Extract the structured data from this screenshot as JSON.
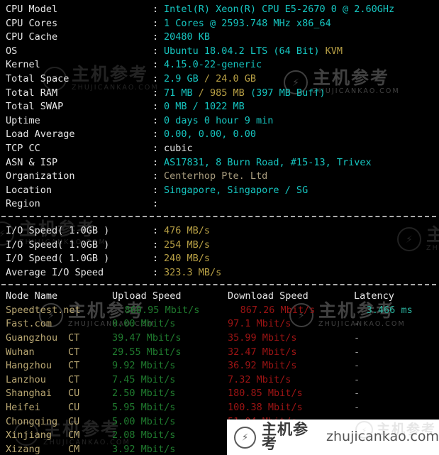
{
  "system_info": {
    "rows": [
      {
        "label": "CPU Model",
        "segments": [
          {
            "text": "Intel(R) Xeon(R) CPU E5-2670 0 @ 2.60GHz",
            "color": "cyan"
          }
        ]
      },
      {
        "label": "CPU Cores",
        "segments": [
          {
            "text": "1 Cores @ 2593.748 MHz x86_64",
            "color": "cyan"
          }
        ]
      },
      {
        "label": "CPU Cache",
        "segments": [
          {
            "text": "20480 KB",
            "color": "cyan"
          }
        ]
      },
      {
        "label": "OS",
        "segments": [
          {
            "text": "Ubuntu 18.04.2 LTS (64 Bit) ",
            "color": "cyan"
          },
          {
            "text": "KVM",
            "color": "yellow"
          }
        ]
      },
      {
        "label": "Kernel",
        "segments": [
          {
            "text": "4.15.0-22-generic",
            "color": "cyan"
          }
        ]
      },
      {
        "label": "Total Space",
        "segments": [
          {
            "text": "2.9 GB ",
            "color": "cyan"
          },
          {
            "text": "/ 24.0 GB",
            "color": "yellow"
          }
        ]
      },
      {
        "label": "Total RAM",
        "segments": [
          {
            "text": "71 MB ",
            "color": "cyan"
          },
          {
            "text": "/ 985 MB ",
            "color": "yellow"
          },
          {
            "text": "(397 MB Buff)",
            "color": "cyan"
          }
        ]
      },
      {
        "label": "Total SWAP",
        "segments": [
          {
            "text": "0 MB / 1022 MB",
            "color": "cyan"
          }
        ]
      },
      {
        "label": "Uptime",
        "segments": [
          {
            "text": "0 days 0 hour 9 min",
            "color": "cyan"
          }
        ]
      },
      {
        "label": "Load Average",
        "segments": [
          {
            "text": "0.00, 0.00, 0.00",
            "color": "cyan"
          }
        ]
      },
      {
        "label": "TCP CC",
        "segments": [
          {
            "text": "cubic",
            "color": "white"
          }
        ]
      },
      {
        "label": "ASN & ISP",
        "segments": [
          {
            "text": "AS17831, 8 Burn Road, #15-13, Trivex",
            "color": "cyan"
          }
        ]
      },
      {
        "label": "Organization",
        "segments": [
          {
            "text": "Centerhop Pte. Ltd",
            "color": "tan"
          }
        ]
      },
      {
        "label": "Location",
        "segments": [
          {
            "text": "Singapore, Singapore / SG",
            "color": "cyan"
          }
        ]
      },
      {
        "label": "Region",
        "segments": [
          {
            "text": "",
            "color": "cyan"
          }
        ]
      }
    ]
  },
  "io_test": {
    "rows": [
      {
        "label": "I/O Speed( 1.0GB )",
        "value": "476 MB/s"
      },
      {
        "label": "I/O Speed( 1.0GB )",
        "value": "254 MB/s"
      },
      {
        "label": "I/O Speed( 1.0GB )",
        "value": "240 MB/s"
      },
      {
        "label": "Average I/O Speed",
        "value": "323.3 MB/s"
      }
    ]
  },
  "speedtest": {
    "headers": {
      "node": "Node Name",
      "isp": "",
      "upload": "Upload Speed",
      "download": "Download Speed",
      "latency": "Latency"
    },
    "rows": [
      {
        "node": "Speedtest.net",
        "isp": "",
        "upload": "860.95 Mbit/s",
        "download": "867.26 Mbit/s",
        "latency": "3.466 ms"
      },
      {
        "node": "Fast.com",
        "isp": "",
        "upload": "0.00 Mbit/s",
        "download": "97.1 Mbit/s",
        "latency": "-"
      },
      {
        "node": "Guangzhou",
        "isp": "CT",
        "upload": "39.47 Mbit/s",
        "download": "35.99 Mbit/s",
        "latency": "-"
      },
      {
        "node": "Wuhan",
        "isp": "CT",
        "upload": "29.55 Mbit/s",
        "download": "32.47 Mbit/s",
        "latency": "-"
      },
      {
        "node": "Hangzhou",
        "isp": "CT",
        "upload": "9.92 Mbit/s",
        "download": "36.92 Mbit/s",
        "latency": "-"
      },
      {
        "node": "Lanzhou",
        "isp": "CT",
        "upload": "7.45 Mbit/s",
        "download": "7.32 Mbit/s",
        "latency": "-"
      },
      {
        "node": "Shanghai",
        "isp": "CU",
        "upload": "2.50 Mbit/s",
        "download": "180.85 Mbit/s",
        "latency": "-"
      },
      {
        "node": "Heifei",
        "isp": "CU",
        "upload": "5.95 Mbit/s",
        "download": "100.38 Mbit/s",
        "latency": "-"
      },
      {
        "node": "Chongqing",
        "isp": "CU",
        "upload": "5.00 Mbit/s",
        "download": "51.04 Mbit/s",
        "latency": "-"
      },
      {
        "node": "Xinjiang",
        "isp": "CM",
        "upload": "2.08 Mbit/s",
        "download": "",
        "latency": ""
      },
      {
        "node": "Xizang",
        "isp": "CM",
        "upload": "3.92 Mbit/s",
        "download": "",
        "latency": ""
      }
    ]
  },
  "watermark": {
    "chinese": "主机参考",
    "domain_caps": "ZHUJICANKAO.COM",
    "domain": "zhujicankao.com",
    "logo_icon": "lightning-circle-icon"
  },
  "colors": {
    "background": "#000000",
    "label": "#e6e6e6",
    "cyan": "#16c5c0",
    "yellow": "#b8a045",
    "tan": "#a89c7e",
    "upload_green": "#1f7a2e",
    "download_red": "#9c1414",
    "latency_teal": "#2bb5a0"
  }
}
